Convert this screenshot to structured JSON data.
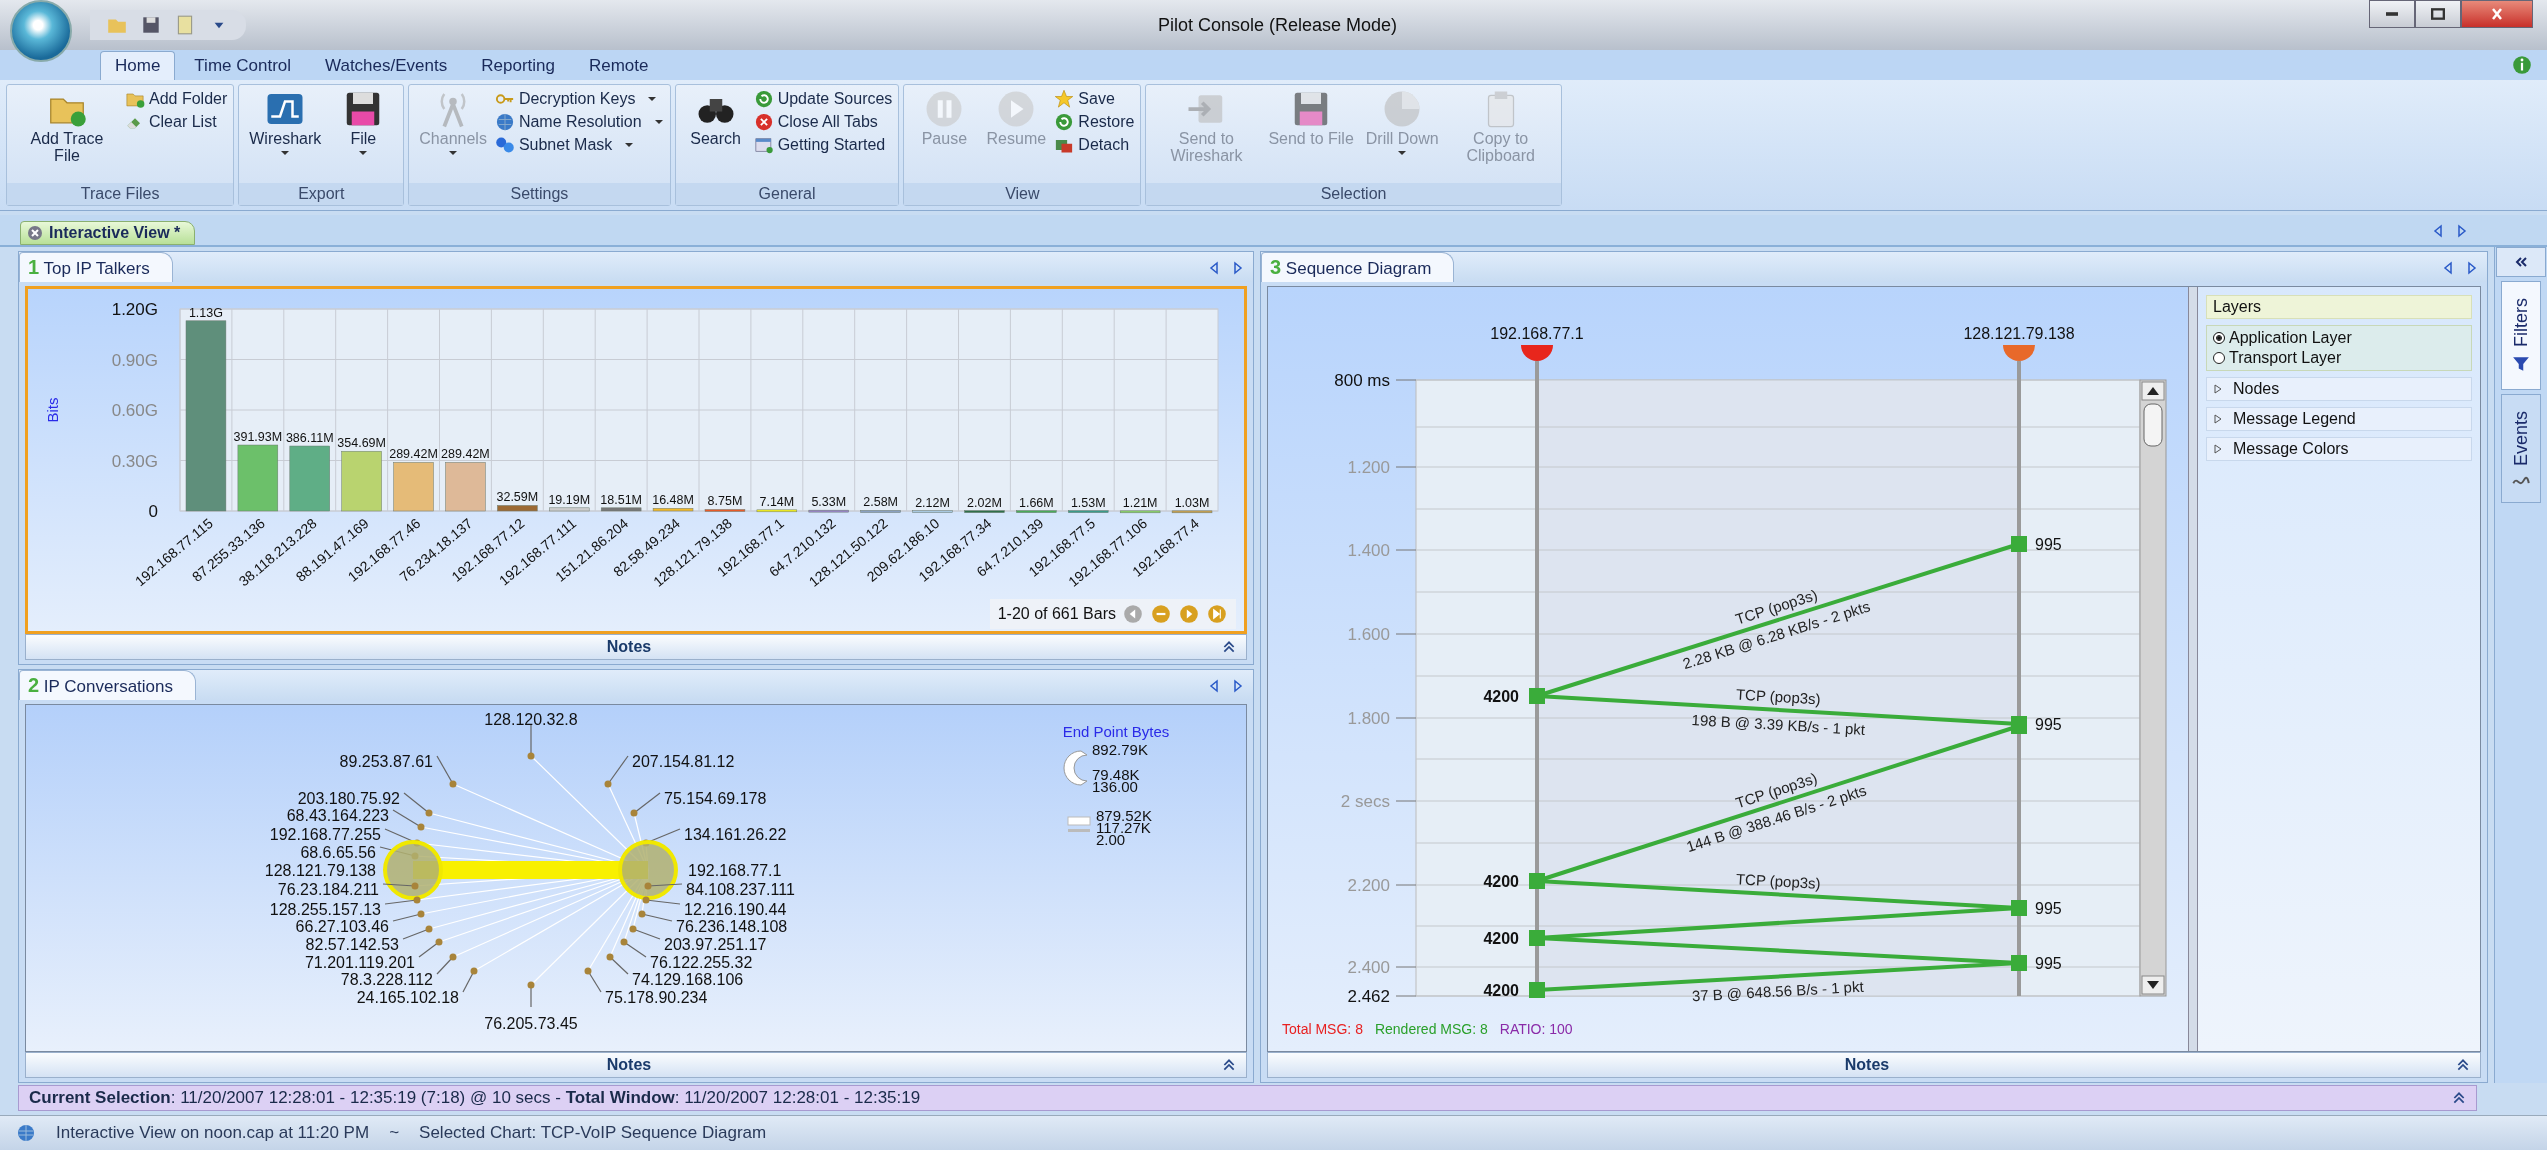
{
  "window": {
    "title": "Pilot Console (Release Mode)"
  },
  "ribbon_tabs": [
    {
      "label": "Home",
      "selected": true
    },
    {
      "label": "Time Control",
      "selected": false
    },
    {
      "label": "Watches/Events",
      "selected": false
    },
    {
      "label": "Reporting",
      "selected": false
    },
    {
      "label": "Remote",
      "selected": false
    }
  ],
  "ribbon_groups": [
    {
      "label": "Trace Files",
      "large": [
        {
          "label": "Add Trace File",
          "disabled": false,
          "dropdown": false
        }
      ],
      "small": [
        {
          "label": "Add Folder",
          "disabled": false,
          "dropdown": false
        },
        {
          "label": "Clear List",
          "disabled": false,
          "dropdown": false
        }
      ]
    },
    {
      "label": "Export",
      "large": [
        {
          "label": "Wireshark",
          "disabled": false,
          "dropdown": true
        },
        {
          "label": "File",
          "disabled": false,
          "dropdown": true
        }
      ]
    },
    {
      "label": "Settings",
      "large": [
        {
          "label": "Channels",
          "disabled": true,
          "dropdown": true
        }
      ],
      "small": [
        {
          "label": "Decryption Keys",
          "disabled": false,
          "dropdown": true
        },
        {
          "label": "Name Resolution",
          "disabled": false,
          "dropdown": true
        },
        {
          "label": "Subnet Mask",
          "disabled": false,
          "dropdown": true
        }
      ]
    },
    {
      "label": "General",
      "large": [
        {
          "label": "Search",
          "disabled": false,
          "dropdown": false
        }
      ],
      "small": [
        {
          "label": "Update Sources",
          "disabled": false,
          "dropdown": false
        },
        {
          "label": "Close All Tabs",
          "disabled": false,
          "dropdown": false
        },
        {
          "label": "Getting Started",
          "disabled": false,
          "dropdown": false
        }
      ]
    },
    {
      "label": "View",
      "large": [
        {
          "label": "Pause",
          "disabled": true,
          "dropdown": false
        },
        {
          "label": "Resume",
          "disabled": true,
          "dropdown": false
        }
      ],
      "small": [
        {
          "label": "Save",
          "disabled": false,
          "dropdown": false
        },
        {
          "label": "Restore",
          "disabled": false,
          "dropdown": false
        },
        {
          "label": "Detach",
          "disabled": false,
          "dropdown": false
        }
      ]
    },
    {
      "label": "Selection",
      "large": [
        {
          "label": "Send to Wireshark",
          "disabled": true,
          "dropdown": false
        },
        {
          "label": "Send to File",
          "disabled": true,
          "dropdown": false
        },
        {
          "label": "Drill Down",
          "disabled": true,
          "dropdown": true
        },
        {
          "label": "Copy to Clipboard",
          "disabled": true,
          "dropdown": false
        }
      ]
    }
  ],
  "view_tab": {
    "label": "Interactive View *"
  },
  "talkers": {
    "number": "1",
    "title": "Top IP Talkers",
    "notes": "Notes",
    "pager": "1-20 of 661 Bars",
    "chart_data": {
      "type": "bar",
      "ylabel": "Bits",
      "grid": true,
      "categories": [
        "192.168.77.115",
        "87.255.33.136",
        "38.118.213.228",
        "88.191.47.169",
        "192.168.77.46",
        "76.234.18.137",
        "192.168.77.12",
        "192.168.77.111",
        "151.21.86.204",
        "82.58.49.234",
        "128.121.79.138",
        "192.168.77.1",
        "64.7.210.132",
        "128.121.50.122",
        "209.62.186.10",
        "192.168.77.34",
        "64.7.210.139",
        "192.168.77.5",
        "192.168.77.106",
        "192.168.77.4"
      ],
      "series": [
        {
          "values": [
            1.13,
            0.392,
            0.386,
            0.355,
            0.289,
            0.289,
            0.033,
            0.019,
            0.019,
            0.016,
            0.009,
            0.007,
            0.005,
            0.003,
            0.002,
            0.002,
            0.002,
            0.002,
            0.001,
            0.001
          ]
        }
      ],
      "value_labels": [
        "1.13G",
        "391.93M",
        "386.11M",
        "354.69M",
        "289.42M",
        "289.42M",
        "32.59M",
        "19.19M",
        "18.51M",
        "16.48M",
        "8.75M",
        "7.14M",
        "5.33M",
        "2.58M",
        "2.12M",
        "2.02M",
        "1.66M",
        "1.53M",
        "1.21M",
        "1.03M"
      ],
      "ylim": [
        0,
        1.2
      ],
      "yticks": [
        {
          "value": 0,
          "label": "0"
        },
        {
          "value": 0.3,
          "label": "0.30G"
        },
        {
          "value": 0.6,
          "label": "0.60G"
        },
        {
          "value": 0.9,
          "label": "0.90G"
        },
        {
          "value": 1.2,
          "label": "1.20G"
        }
      ]
    }
  },
  "conversations": {
    "number": "2",
    "title": "IP Conversations",
    "notes": "Notes",
    "nodes": [
      {
        "label": "128.120.32.8",
        "selected": false
      },
      {
        "label": "89.253.87.61",
        "selected": false
      },
      {
        "label": "207.154.81.12",
        "selected": false
      },
      {
        "label": "203.180.75.92",
        "selected": false
      },
      {
        "label": "75.154.69.178",
        "selected": false
      },
      {
        "label": "68.43.164.223",
        "selected": false
      },
      {
        "label": "192.168.77.255",
        "selected": false
      },
      {
        "label": "134.161.26.22",
        "selected": false
      },
      {
        "label": "68.6.65.56",
        "selected": false
      },
      {
        "label": "128.121.79.138",
        "selected": true
      },
      {
        "label": "192.168.77.1",
        "selected": true
      },
      {
        "label": "76.23.184.211",
        "selected": false
      },
      {
        "label": "84.108.237.111",
        "selected": false
      },
      {
        "label": "128.255.157.13",
        "selected": false
      },
      {
        "label": "12.216.190.44",
        "selected": false
      },
      {
        "label": "66.27.103.46",
        "selected": false
      },
      {
        "label": "76.236.148.108",
        "selected": false
      },
      {
        "label": "82.57.142.53",
        "selected": false
      },
      {
        "label": "203.97.251.17",
        "selected": false
      },
      {
        "label": "71.201.119.201",
        "selected": false
      },
      {
        "label": "76.122.255.32",
        "selected": false
      },
      {
        "label": "78.3.228.112",
        "selected": false
      },
      {
        "label": "74.129.168.106",
        "selected": false
      },
      {
        "label": "24.165.102.18",
        "selected": false
      },
      {
        "label": "75.178.90.234",
        "selected": false
      },
      {
        "label": "76.205.73.45",
        "selected": false
      }
    ],
    "legend": {
      "title": "End Point Bytes",
      "node_values": [
        "892.79K",
        "79.48K",
        "136.00"
      ],
      "link_values": [
        "879.52K",
        "117.27K",
        "2.00"
      ]
    }
  },
  "sequence": {
    "number": "3",
    "title": "Sequence Diagram",
    "notes": "Notes",
    "lifelines": [
      {
        "label": "192.168.77.1",
        "color": "#e8261c"
      },
      {
        "label": "128.121.79.138",
        "color": "#e8692a"
      }
    ],
    "ticks": [
      "800 ms",
      "1.200",
      "1.400",
      "1.600",
      "1.800",
      "2 secs",
      "2.200",
      "2.400",
      "2.462"
    ],
    "messages": [
      {
        "kind": "tcp",
        "top": "TCP (pop3s)",
        "bottom": "2.28 KB @ 6.28 KB/s - 2 pkts"
      },
      {
        "kind": "tcp",
        "top": "TCP (pop3s)",
        "bottom": "198 B @ 3.39 KB/s - 1 pkt"
      },
      {
        "kind": "tcp",
        "top": "TCP (pop3s)",
        "bottom": "144 B @ 388.46 B/s - 2 pkts"
      },
      {
        "kind": "tcp",
        "top": "TCP (pop3s)"
      },
      {
        "kind": "tcp"
      },
      {
        "kind": "tcp"
      },
      {
        "kind": "tcp",
        "bottom": "37 B @ 648.56 B/s - 1 pkt"
      }
    ],
    "ports": [
      {
        "kind": "right",
        "label": "995"
      },
      {
        "kind": "left",
        "label": "4200"
      },
      {
        "kind": "right",
        "label": "995"
      },
      {
        "kind": "left",
        "label": "4200"
      },
      {
        "kind": "right",
        "label": "995"
      },
      {
        "kind": "left",
        "label": "4200"
      },
      {
        "kind": "right",
        "label": "995"
      },
      {
        "kind": "left",
        "label": "4200"
      }
    ],
    "stats": [
      {
        "label": "Total MSG: 8",
        "color": "#e82020"
      },
      {
        "label": "Rendered MSG: 8",
        "color": "#2aa02a"
      },
      {
        "label": "RATIO: 100",
        "color": "#8a2aa8"
      }
    ],
    "layers": {
      "title": "Layers",
      "options": [
        {
          "label": "Application Layer",
          "selected": true
        },
        {
          "label": "Transport Layer",
          "selected": false
        }
      ],
      "sections": [
        "Nodes",
        "Message Legend",
        "Message Colors"
      ]
    }
  },
  "side_tabs": [
    {
      "label": "Filters",
      "selected": true
    },
    {
      "label": "Events",
      "selected": false
    }
  ],
  "selection_bar": "**Current Selection**: 11/20/2007 12:28:01 - 12:35:19 (7:18) @ 10 secs  -  **Total Window**: 11/20/2007 12:28:01 - 12:35:19",
  "status_bar": [
    "Interactive View on noon.cap at 11:20 PM",
    "~",
    "Selected Chart: TCP-VoIP Sequence Diagram"
  ]
}
